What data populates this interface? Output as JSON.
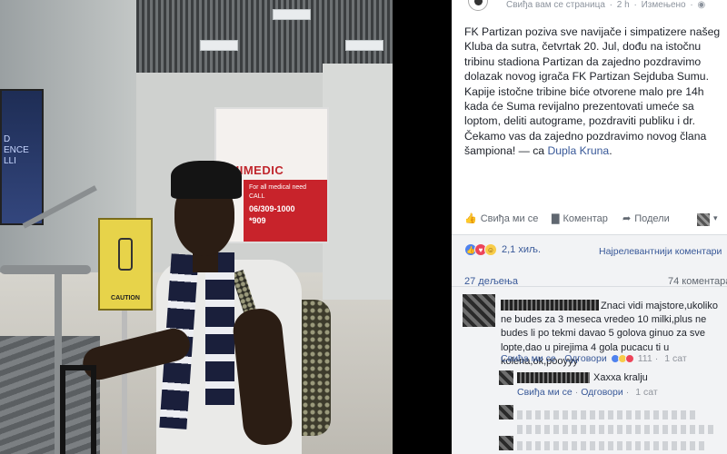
{
  "post": {
    "meta_text": "Свиђа вам се страница",
    "meta_time": "2 h",
    "meta_edited": "Измењено",
    "text": "FK Partizan poziva sve navijače i simpatizere našeg Kluba da sutra, četvrtak 20. Jul, dođu na istočnu tribinu stadiona Partizan da zajedno pozdravimo dolazak novog igrača FK Partizan Sejduba Sumu. Kapije istočne tribine biće otvorene malo pre 14h kada će Suma revijalno prezentovati umeće sa loptom, deliti autograme, pozdraviti publiku i dr. Čekamo vas da zajedno pozdravimo novog člana šampiona!",
    "tag_prefix": " — са ",
    "tag_link": "Dupla Kruna",
    "tag_suffix": "."
  },
  "actions": {
    "like": "Свиђа ми се",
    "comment": "Коментар",
    "share": "Подели"
  },
  "stats": {
    "reaction_count": "2,1 хиљ.",
    "sort_label": "Најрелевантнији коментари",
    "shares": "27 дељења",
    "comments": "74 коментара"
  },
  "comments": [
    {
      "text": "Znaci vidi majstore,ukoliko ne budes za 3 meseca vredeo 10 milki,plus ne budes li po tekmi davao 5 golova ginuo za sve lopte,dao u pirejima 4 gola pucacu ti u kolena,ok,pooyyy",
      "like": "Свиђа ми се",
      "reply": "Одговори",
      "reactions": "111",
      "time": "1 сат"
    },
    {
      "text": "Хахха kralju",
      "like": "Свиђа ми се",
      "reply": "Одговори",
      "time": "1 сат"
    }
  ],
  "photo": {
    "led_ad_text": "D\nENCE\nLLI",
    "medic_logo": "ELIIMEDIC",
    "medic_band_text": "For all medical need\nCALL",
    "medic_phone_1": "06/309-1000",
    "medic_phone_2": "*909",
    "caution_label": "CAUTION"
  }
}
